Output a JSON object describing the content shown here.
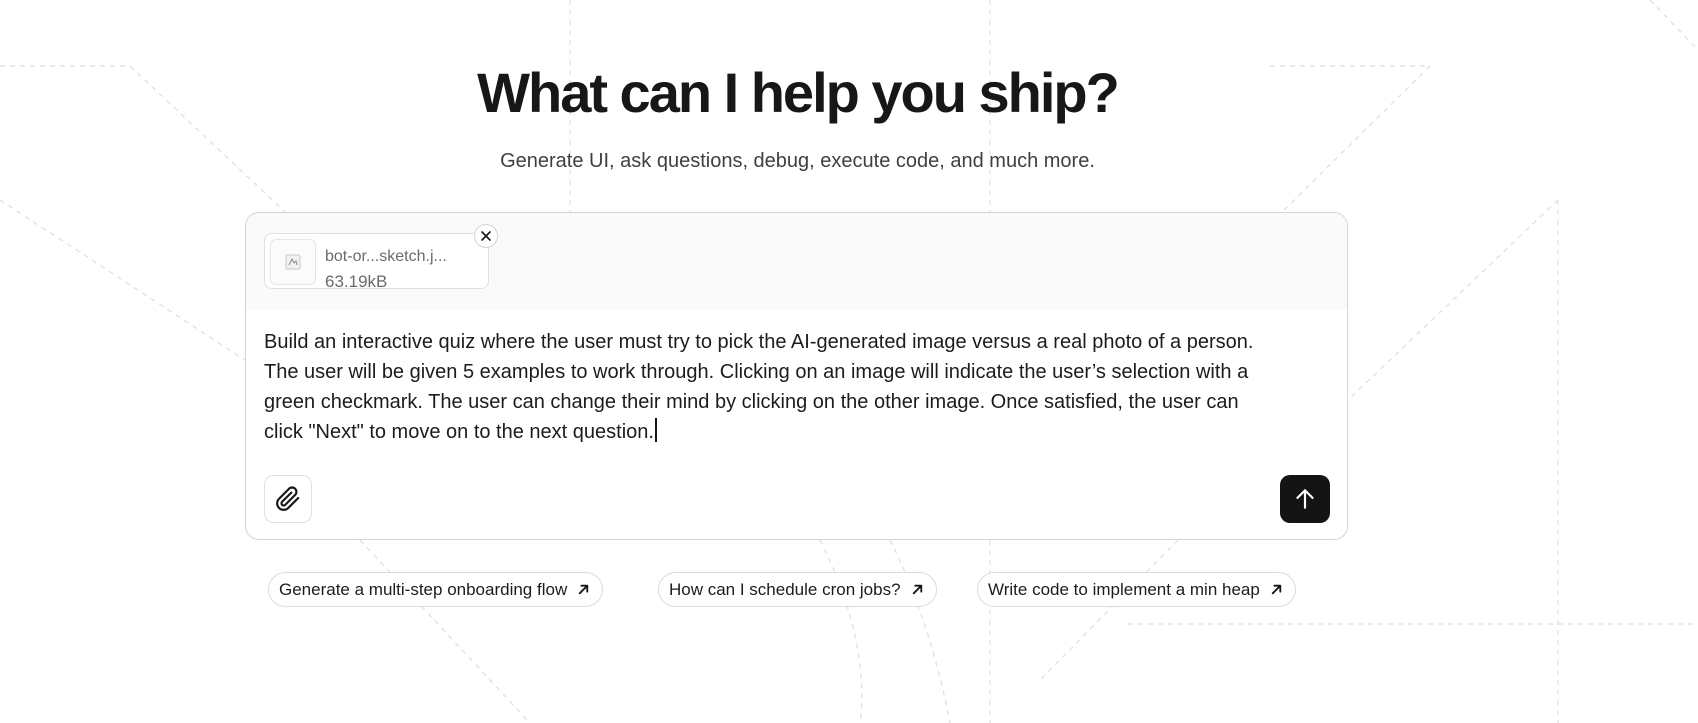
{
  "hero": {
    "title": "What can I help you ship?",
    "subtitle": "Generate UI, ask questions, debug, execute code, and much more."
  },
  "composer": {
    "attachment": {
      "file_name": "bot-or...sketch.j...",
      "file_size": "63.19kB",
      "thumbnail_icon": "image-thumbnail-icon",
      "remove_icon": "close-icon"
    },
    "prompt_text": "Build an interactive quiz where the user must try to pick the AI-generated image versus a real photo of a person. The user will be given 5 examples to work through. Clicking on an image will indicate the user’s selection with a green checkmark. The user can change their mind by clicking on the other image. Once satisfied, the user can click \"Next\" to move on to the next question.",
    "attach_icon": "paperclip-icon",
    "send_icon": "arrow-up-icon"
  },
  "suggestions": [
    {
      "label": "Generate a multi-step onboarding flow",
      "icon": "arrow-up-right-icon"
    },
    {
      "label": "How can I schedule cron jobs?",
      "icon": "arrow-up-right-icon"
    },
    {
      "label": "Write code to implement a min heap",
      "icon": "arrow-up-right-icon"
    }
  ],
  "colors": {
    "background": "#ffffff",
    "text": "#171717",
    "muted_text": "#3f3f3f",
    "border": "#d4d4d4",
    "send_button": "#141414"
  }
}
